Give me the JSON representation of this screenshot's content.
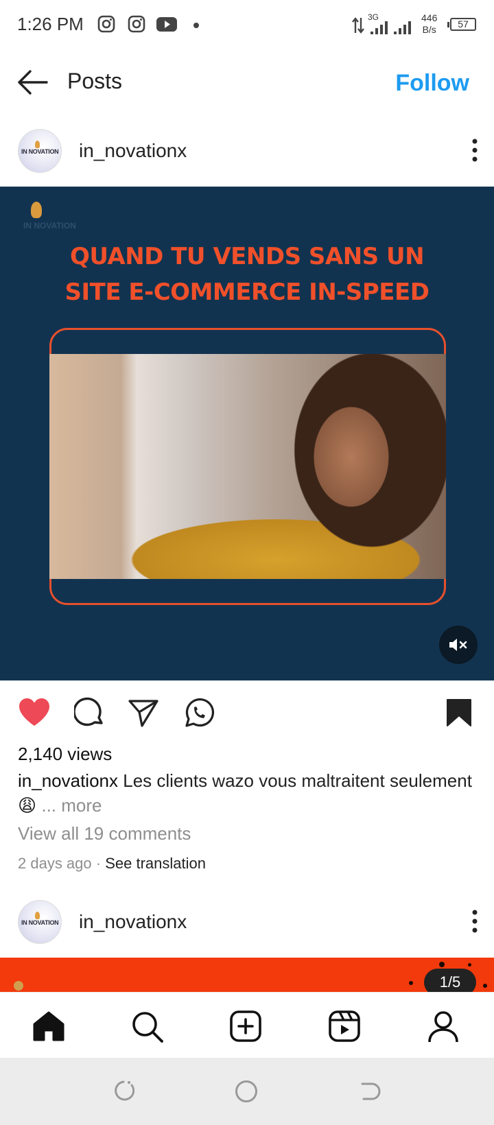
{
  "status_bar": {
    "time": "1:26 PM",
    "icons": [
      "instagram-icon",
      "instagram-icon",
      "youtube-icon",
      "notification-dot"
    ],
    "network": "3G",
    "speed_value": "446",
    "speed_unit": "B/s",
    "battery": "57"
  },
  "header": {
    "title": "Posts",
    "follow_label": "Follow"
  },
  "post": {
    "username": "in_novationx",
    "avatar_text": "IN NOVATION",
    "media": {
      "brand": "IN NOVATION",
      "headline_line1": "QUAND TU VENDS SANS UN",
      "headline_line2": "SITE E-COMMERCE IN-SPEED"
    },
    "liked": true,
    "saved": true,
    "views": "2,140 views",
    "caption_user": "in_novationx",
    "caption_text": "Les clients wazo vous maltraitent seulement",
    "caption_emoji": "😩",
    "more_label": "... more",
    "view_comments": "View all 19 comments",
    "time_ago": "2 days ago",
    "separator": " · ",
    "see_translation": "See translation"
  },
  "next_post": {
    "username": "in_novationx",
    "avatar_text": "IN NOVATION",
    "page_counter": "1/5"
  },
  "colors": {
    "accent": "#1d9bf0",
    "like": "#ed4956",
    "media_bg": "#123350",
    "headline": "#f0502a",
    "next_media_bg": "#f23a0c"
  },
  "bottom_nav": [
    "home-icon",
    "search-icon",
    "create-icon",
    "reels-icon",
    "profile-icon"
  ]
}
